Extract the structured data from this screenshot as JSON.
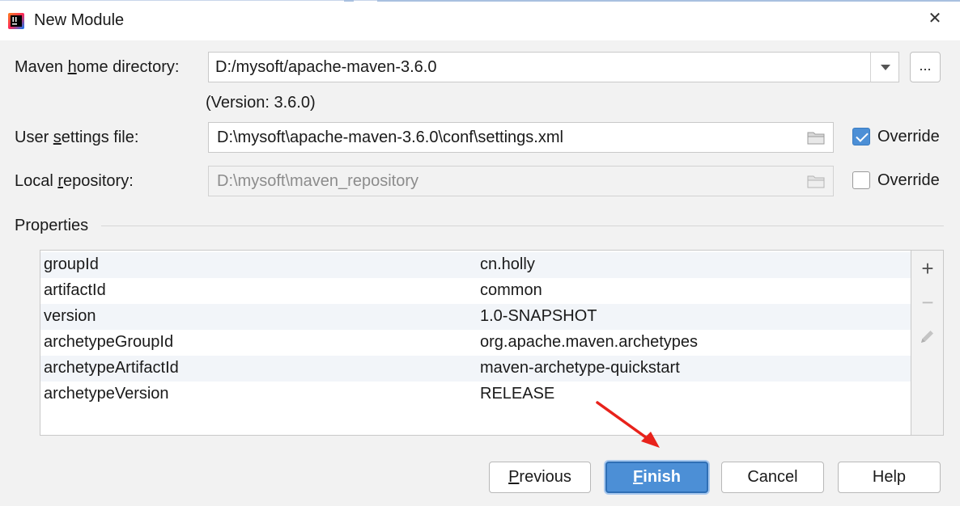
{
  "window": {
    "title": "New Module",
    "close_glyph": "✕"
  },
  "maven_home": {
    "label_pre": "Maven ",
    "label_u": "h",
    "label_post": "ome directory:",
    "value": "D:/mysoft/apache-maven-3.6.0",
    "browse_label": "...",
    "version_text": "(Version: 3.6.0)"
  },
  "user_settings": {
    "label_pre": "User ",
    "label_u": "s",
    "label_post": "ettings file:",
    "value": "D:\\mysoft\\apache-maven-3.6.0\\conf\\settings.xml",
    "override_label": "Override",
    "override_checked": true
  },
  "local_repo": {
    "label_pre": "Local ",
    "label_u": "r",
    "label_post": "epository:",
    "value": "D:\\mysoft\\maven_repository",
    "override_label": "Override",
    "override_checked": false
  },
  "properties": {
    "section_label": "Properties",
    "rows": [
      {
        "key": "groupId",
        "value": "cn.holly"
      },
      {
        "key": "artifactId",
        "value": "common"
      },
      {
        "key": "version",
        "value": "1.0-SNAPSHOT"
      },
      {
        "key": "archetypeGroupId",
        "value": "org.apache.maven.archetypes"
      },
      {
        "key": "archetypeArtifactId",
        "value": "maven-archetype-quickstart"
      },
      {
        "key": "archetypeVersion",
        "value": "RELEASE"
      }
    ],
    "add_glyph": "+",
    "remove_glyph": "−"
  },
  "buttons": {
    "previous_u": "P",
    "previous_rest": "revious",
    "finish_u": "F",
    "finish_rest": "inish",
    "cancel": "Cancel",
    "help": "Help"
  },
  "colors": {
    "accent": "#4c8fd6",
    "annotation_arrow": "#e8221b"
  },
  "icons": [
    "intellij-app-icon",
    "close-icon",
    "dropdown-arrow-icon",
    "folder-icon",
    "checkmark-icon",
    "add-icon",
    "remove-icon",
    "edit-pencil-icon",
    "red-arrow-annotation"
  ]
}
